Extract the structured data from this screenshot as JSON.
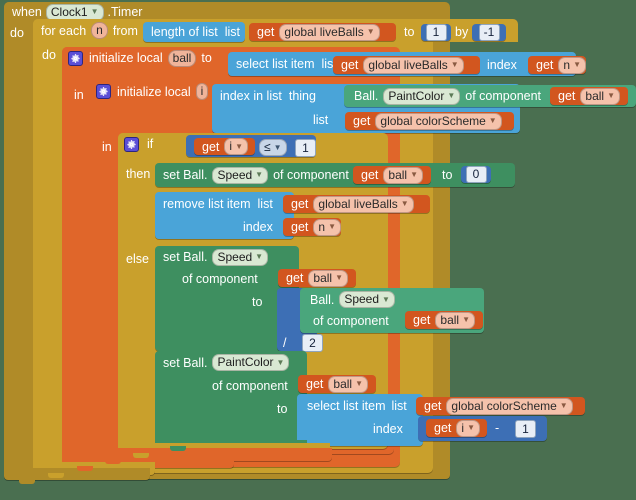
{
  "workspace": {
    "background_color": "#4a6f50",
    "language": "MIT App Inventor Blocks"
  },
  "palette": {
    "event": "#b08b28",
    "control": "#c9a02c",
    "variable": "#e0662a",
    "variable_dark": "#d2561f",
    "list": "#4aa4d8",
    "component_set": "#3e8f60",
    "component_get": "#4aa67c",
    "math": "#3d6fb5"
  },
  "event_block": {
    "when_label": "when",
    "component": "Clock1",
    "event": ".Timer",
    "do_label": "do"
  },
  "for_each": {
    "for_each_label": "for each",
    "var": "n",
    "from_label": "from",
    "length_of_list_label": "length of list",
    "list_label": "list",
    "get_label": "get",
    "list_var": "global liveBalls",
    "to_label": "to",
    "to_value": "1",
    "by_label": "by",
    "by_value": "-1",
    "do_label": "do"
  },
  "init_ball": {
    "init_label": "initialize local",
    "var": "ball",
    "to_label": "to",
    "select_list_item_label": "select list item",
    "list_label": "list",
    "get_label": "get",
    "list_var": "global liveBalls",
    "index_label": "index",
    "index_get_label": "get",
    "index_var": "n",
    "in_label": "in"
  },
  "init_i": {
    "init_label": "initialize local",
    "var": "i",
    "to_label": "to",
    "index_in_list_label": "index in list",
    "thing_label": "thing",
    "component": "Ball.",
    "property": "PaintColor",
    "of_component_label": "of component",
    "get_label": "get",
    "component_var": "ball",
    "list_label": "list",
    "list_get_label": "get",
    "list_var": "global colorScheme",
    "in_label": "in"
  },
  "if_block": {
    "if_label": "if",
    "then_label": "then",
    "else_label": "else",
    "condition": {
      "get_label": "get",
      "left_var": "i",
      "operator": "≤",
      "right_value": "1"
    }
  },
  "then_branch": {
    "set_speed": {
      "set_label": "set Ball.",
      "property": "Speed",
      "of_component_label": "of component",
      "get_label": "get",
      "component_var": "ball",
      "to_label": "to",
      "value": "0"
    },
    "remove_item": {
      "remove_label": "remove list item",
      "list_label": "list",
      "get_label": "get",
      "list_var": "global liveBalls",
      "index_label": "index",
      "index_get_label": "get",
      "index_var": "n"
    }
  },
  "else_branch": {
    "set_speed": {
      "set_label": "set Ball.",
      "property": "Speed",
      "of_component_label": "of component",
      "get_label": "get",
      "component_var": "ball",
      "to_label": "to",
      "divide_operator": "/",
      "divisor": "2",
      "getter": {
        "component": "Ball.",
        "property": "Speed",
        "of_component_label": "of component",
        "get_label": "get",
        "component_var": "ball"
      }
    },
    "set_paintcolor": {
      "set_label": "set Ball.",
      "property": "PaintColor",
      "of_component_label": "of component",
      "get_label": "get",
      "component_var": "ball",
      "to_label": "to",
      "select_list_item_label": "select list item",
      "list_label": "list",
      "list_get_label": "get",
      "list_var": "global colorScheme",
      "index_label": "index",
      "index_get_label": "get",
      "index_var": "i",
      "minus_operator": "-",
      "minus_value": "1"
    }
  },
  "icons": {
    "mutator": "gear-icon",
    "dropdown": "chevron-down-icon"
  }
}
